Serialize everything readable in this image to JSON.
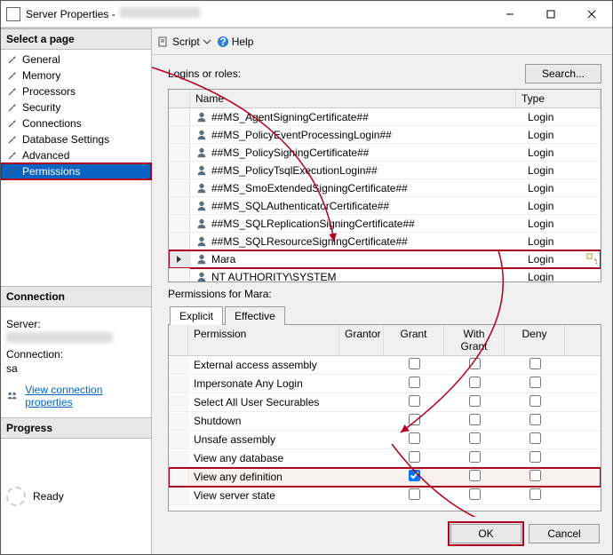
{
  "title_prefix": "Server Properties - ",
  "sidepanel": {
    "select_page": "Select a page",
    "items": [
      {
        "label": "General"
      },
      {
        "label": "Memory"
      },
      {
        "label": "Processors"
      },
      {
        "label": "Security"
      },
      {
        "label": "Connections"
      },
      {
        "label": "Database Settings"
      },
      {
        "label": "Advanced"
      },
      {
        "label": "Permissions",
        "selected": true
      }
    ],
    "connection_hdr": "Connection",
    "server_lbl": "Server:",
    "connection_lbl": "Connection:",
    "connection_val": "sa",
    "view_conn_props": "View connection properties",
    "progress_hdr": "Progress",
    "progress_ready": "Ready"
  },
  "toolbar": {
    "script": "Script",
    "help": "Help"
  },
  "main": {
    "logins_label": "Logins or roles:",
    "search_btn": "Search...",
    "grid_headers": {
      "name": "Name",
      "type": "Type"
    },
    "logins": [
      {
        "name": "##MS_AgentSigningCertificate##",
        "type": "Login"
      },
      {
        "name": "##MS_PolicyEventProcessingLogin##",
        "type": "Login"
      },
      {
        "name": "##MS_PolicySigningCertificate##",
        "type": "Login"
      },
      {
        "name": "##MS_PolicyTsqlExecutionLogin##",
        "type": "Login"
      },
      {
        "name": "##MS_SmoExtendedSigningCertificate##",
        "type": "Login"
      },
      {
        "name": "##MS_SQLAuthenticatorCertificate##",
        "type": "Login"
      },
      {
        "name": "##MS_SQLReplicationSigningCertificate##",
        "type": "Login"
      },
      {
        "name": "##MS_SQLResourceSigningCertificate##",
        "type": "Login"
      },
      {
        "name": "Mara",
        "type": "Login",
        "selected": true
      },
      {
        "name": "NT AUTHORITY\\SYSTEM",
        "type": "Login"
      }
    ],
    "permissions_for": "Permissions for Mara:",
    "tabs": {
      "explicit": "Explicit",
      "effective": "Effective"
    },
    "perm_headers": {
      "permission": "Permission",
      "grantor": "Grantor",
      "grant": "Grant",
      "withgrant": "With Grant",
      "deny": "Deny"
    },
    "permissions": [
      {
        "name": "External access assembly",
        "grant": false,
        "withgrant": false,
        "deny": false
      },
      {
        "name": "Impersonate Any Login",
        "grant": false,
        "withgrant": false,
        "deny": false
      },
      {
        "name": "Select All User Securables",
        "grant": false,
        "withgrant": false,
        "deny": false
      },
      {
        "name": "Shutdown",
        "grant": false,
        "withgrant": false,
        "deny": false
      },
      {
        "name": "Unsafe assembly",
        "grant": false,
        "withgrant": false,
        "deny": false
      },
      {
        "name": "View any database",
        "grant": false,
        "withgrant": false,
        "deny": false
      },
      {
        "name": "View any definition",
        "grant": true,
        "withgrant": false,
        "deny": false,
        "highlighted": true
      },
      {
        "name": "View server state",
        "grant": false,
        "withgrant": false,
        "deny": false
      }
    ]
  },
  "footer": {
    "ok": "OK",
    "cancel": "Cancel"
  }
}
